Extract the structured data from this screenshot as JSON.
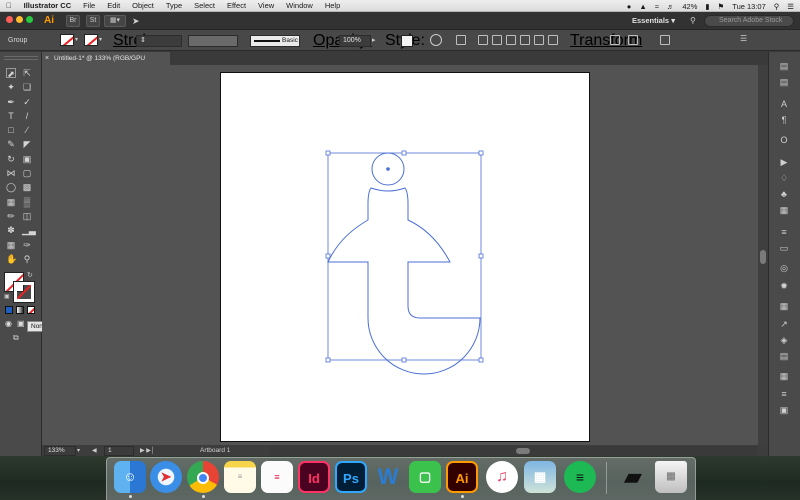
{
  "menubar": {
    "app_name": "Illustrator CC",
    "items": [
      "File",
      "Edit",
      "Object",
      "Type",
      "Select",
      "Effect",
      "View",
      "Window",
      "Help"
    ],
    "battery": "42%",
    "clock": "Tue 13:07"
  },
  "appbar": {
    "logo": "Ai",
    "bridge_label": "Br",
    "stock_label": "St",
    "workspace": "Essentials",
    "search_placeholder": "Search Adobe Stock"
  },
  "control": {
    "selection_label": "Group",
    "stroke_label": "Stroke:",
    "brush_label": "Basic",
    "opacity_label": "Opacity:",
    "opacity_value": "100%",
    "style_label": "Style:",
    "transform_label": "Transform"
  },
  "document": {
    "tab_title": "Untitled-1* @ 133% (RGB/GPU Preview)"
  },
  "tools": {
    "tooltip": "None (/)"
  },
  "status": {
    "zoom": "133%",
    "artboard_number": "1",
    "artboard_name": "Artboard 1"
  },
  "dock": {
    "apps": [
      {
        "name": "finder",
        "label": ""
      },
      {
        "name": "safari",
        "label": ""
      },
      {
        "name": "chrome",
        "label": ""
      },
      {
        "name": "notes",
        "label": ""
      },
      {
        "name": "reminders",
        "label": ""
      },
      {
        "name": "indesign",
        "label": "Id"
      },
      {
        "name": "photoshop",
        "label": "Ps"
      },
      {
        "name": "word",
        "label": "W"
      },
      {
        "name": "facetime",
        "label": ""
      },
      {
        "name": "illustrator",
        "label": "Ai"
      },
      {
        "name": "itunes",
        "label": ""
      },
      {
        "name": "preview",
        "label": ""
      },
      {
        "name": "spotify",
        "label": ""
      },
      {
        "name": "shirt-file",
        "label": ""
      },
      {
        "name": "trash",
        "label": ""
      }
    ]
  },
  "colors": {
    "accent": "#ff9a00",
    "selection_blue": "#4b6fd6",
    "artboard": "#ffffff",
    "canvas": "#535353"
  }
}
